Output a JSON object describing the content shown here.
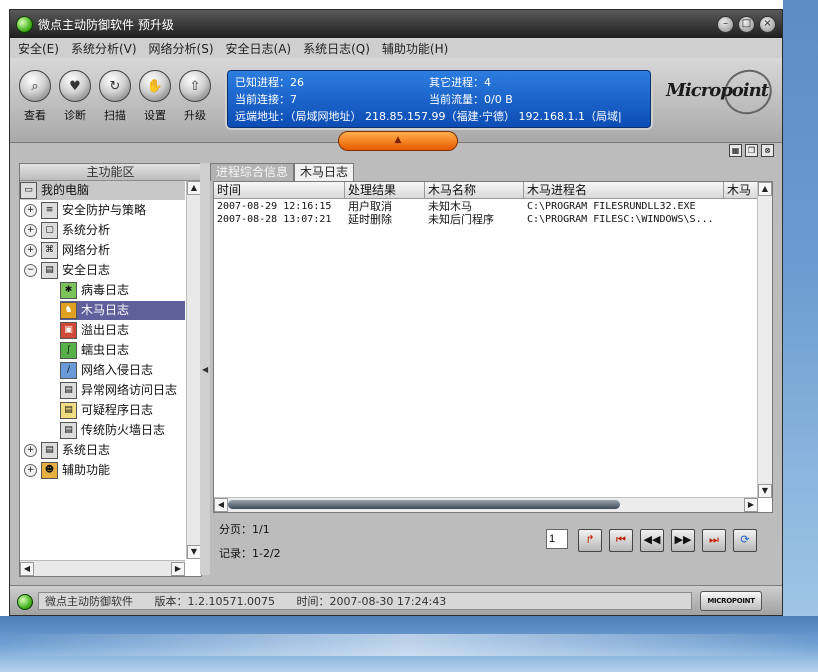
{
  "window": {
    "title": "微点主动防御软件  预升级"
  },
  "menu": [
    "安全(E)",
    "系统分析(V)",
    "网络分析(S)",
    "安全日志(A)",
    "系统日志(Q)",
    "辅助功能(H)"
  ],
  "toolbar": {
    "buttons": [
      {
        "label": "查看",
        "icon": "magnifier-icon"
      },
      {
        "label": "诊断",
        "icon": "heart-icon"
      },
      {
        "label": "扫描",
        "icon": "scan-icon"
      },
      {
        "label": "设置",
        "icon": "hand-icon"
      },
      {
        "label": "升级",
        "icon": "upgrade-icon"
      }
    ]
  },
  "info": {
    "known_processes": "已知进程：26",
    "other_processes": "其它进程：4",
    "current_connections": "当前连接：7",
    "current_traffic": "当前流量：0/0 B",
    "remote_address": "远端地址：（局域网地址） 218.85.157.99（福建·宁德） 192.168.1.1（局域|"
  },
  "brand": {
    "logo_text": "Micropoint"
  },
  "sidebar": {
    "title": "主功能区",
    "root": "我的电脑",
    "items": [
      {
        "label": "安全防护与策略",
        "level": 1,
        "toggle": "+"
      },
      {
        "label": "系统分析",
        "level": 1,
        "toggle": "+"
      },
      {
        "label": "网络分析",
        "level": 1,
        "toggle": "+"
      },
      {
        "label": "安全日志",
        "level": 1,
        "toggle": "−"
      },
      {
        "label": "病毒日志",
        "level": 2
      },
      {
        "label": "木马日志",
        "level": 2,
        "selected": true
      },
      {
        "label": "溢出日志",
        "level": 2
      },
      {
        "label": "蠕虫日志",
        "level": 2
      },
      {
        "label": "网络入侵日志",
        "level": 2
      },
      {
        "label": "异常网络访问日志",
        "level": 2
      },
      {
        "label": "可疑程序日志",
        "level": 2
      },
      {
        "label": "传统防火墙日志",
        "level": 2
      },
      {
        "label": "系统日志",
        "level": 1,
        "toggle": "+"
      },
      {
        "label": "辅助功能",
        "level": 1,
        "toggle": "+"
      }
    ]
  },
  "tabs": [
    "进程综合信息",
    "木马日志"
  ],
  "table": {
    "columns": [
      "时间",
      "处理结果",
      "木马名称",
      "木马进程名",
      "木马"
    ],
    "rows": [
      [
        "2007-08-29 12:16:15",
        "用户取消",
        "未知木马",
        "C:\\PROGRAM FILESRUNDLL32.EXE"
      ],
      [
        "2007-08-28 13:07:21",
        "延时删除",
        "未知后门程序",
        "C:\\PROGRAM FILESC:\\WINDOWS\\S..."
      ]
    ]
  },
  "pager": {
    "page": "分页：1/1",
    "records": "记录：1-2/2",
    "page_input": "1"
  },
  "status": {
    "app": "微点主动防御软件",
    "version": "版本：1.2.10571.0075",
    "time": "时间：2007-08-30 17:24:43",
    "brand": "MICROPOINT"
  }
}
